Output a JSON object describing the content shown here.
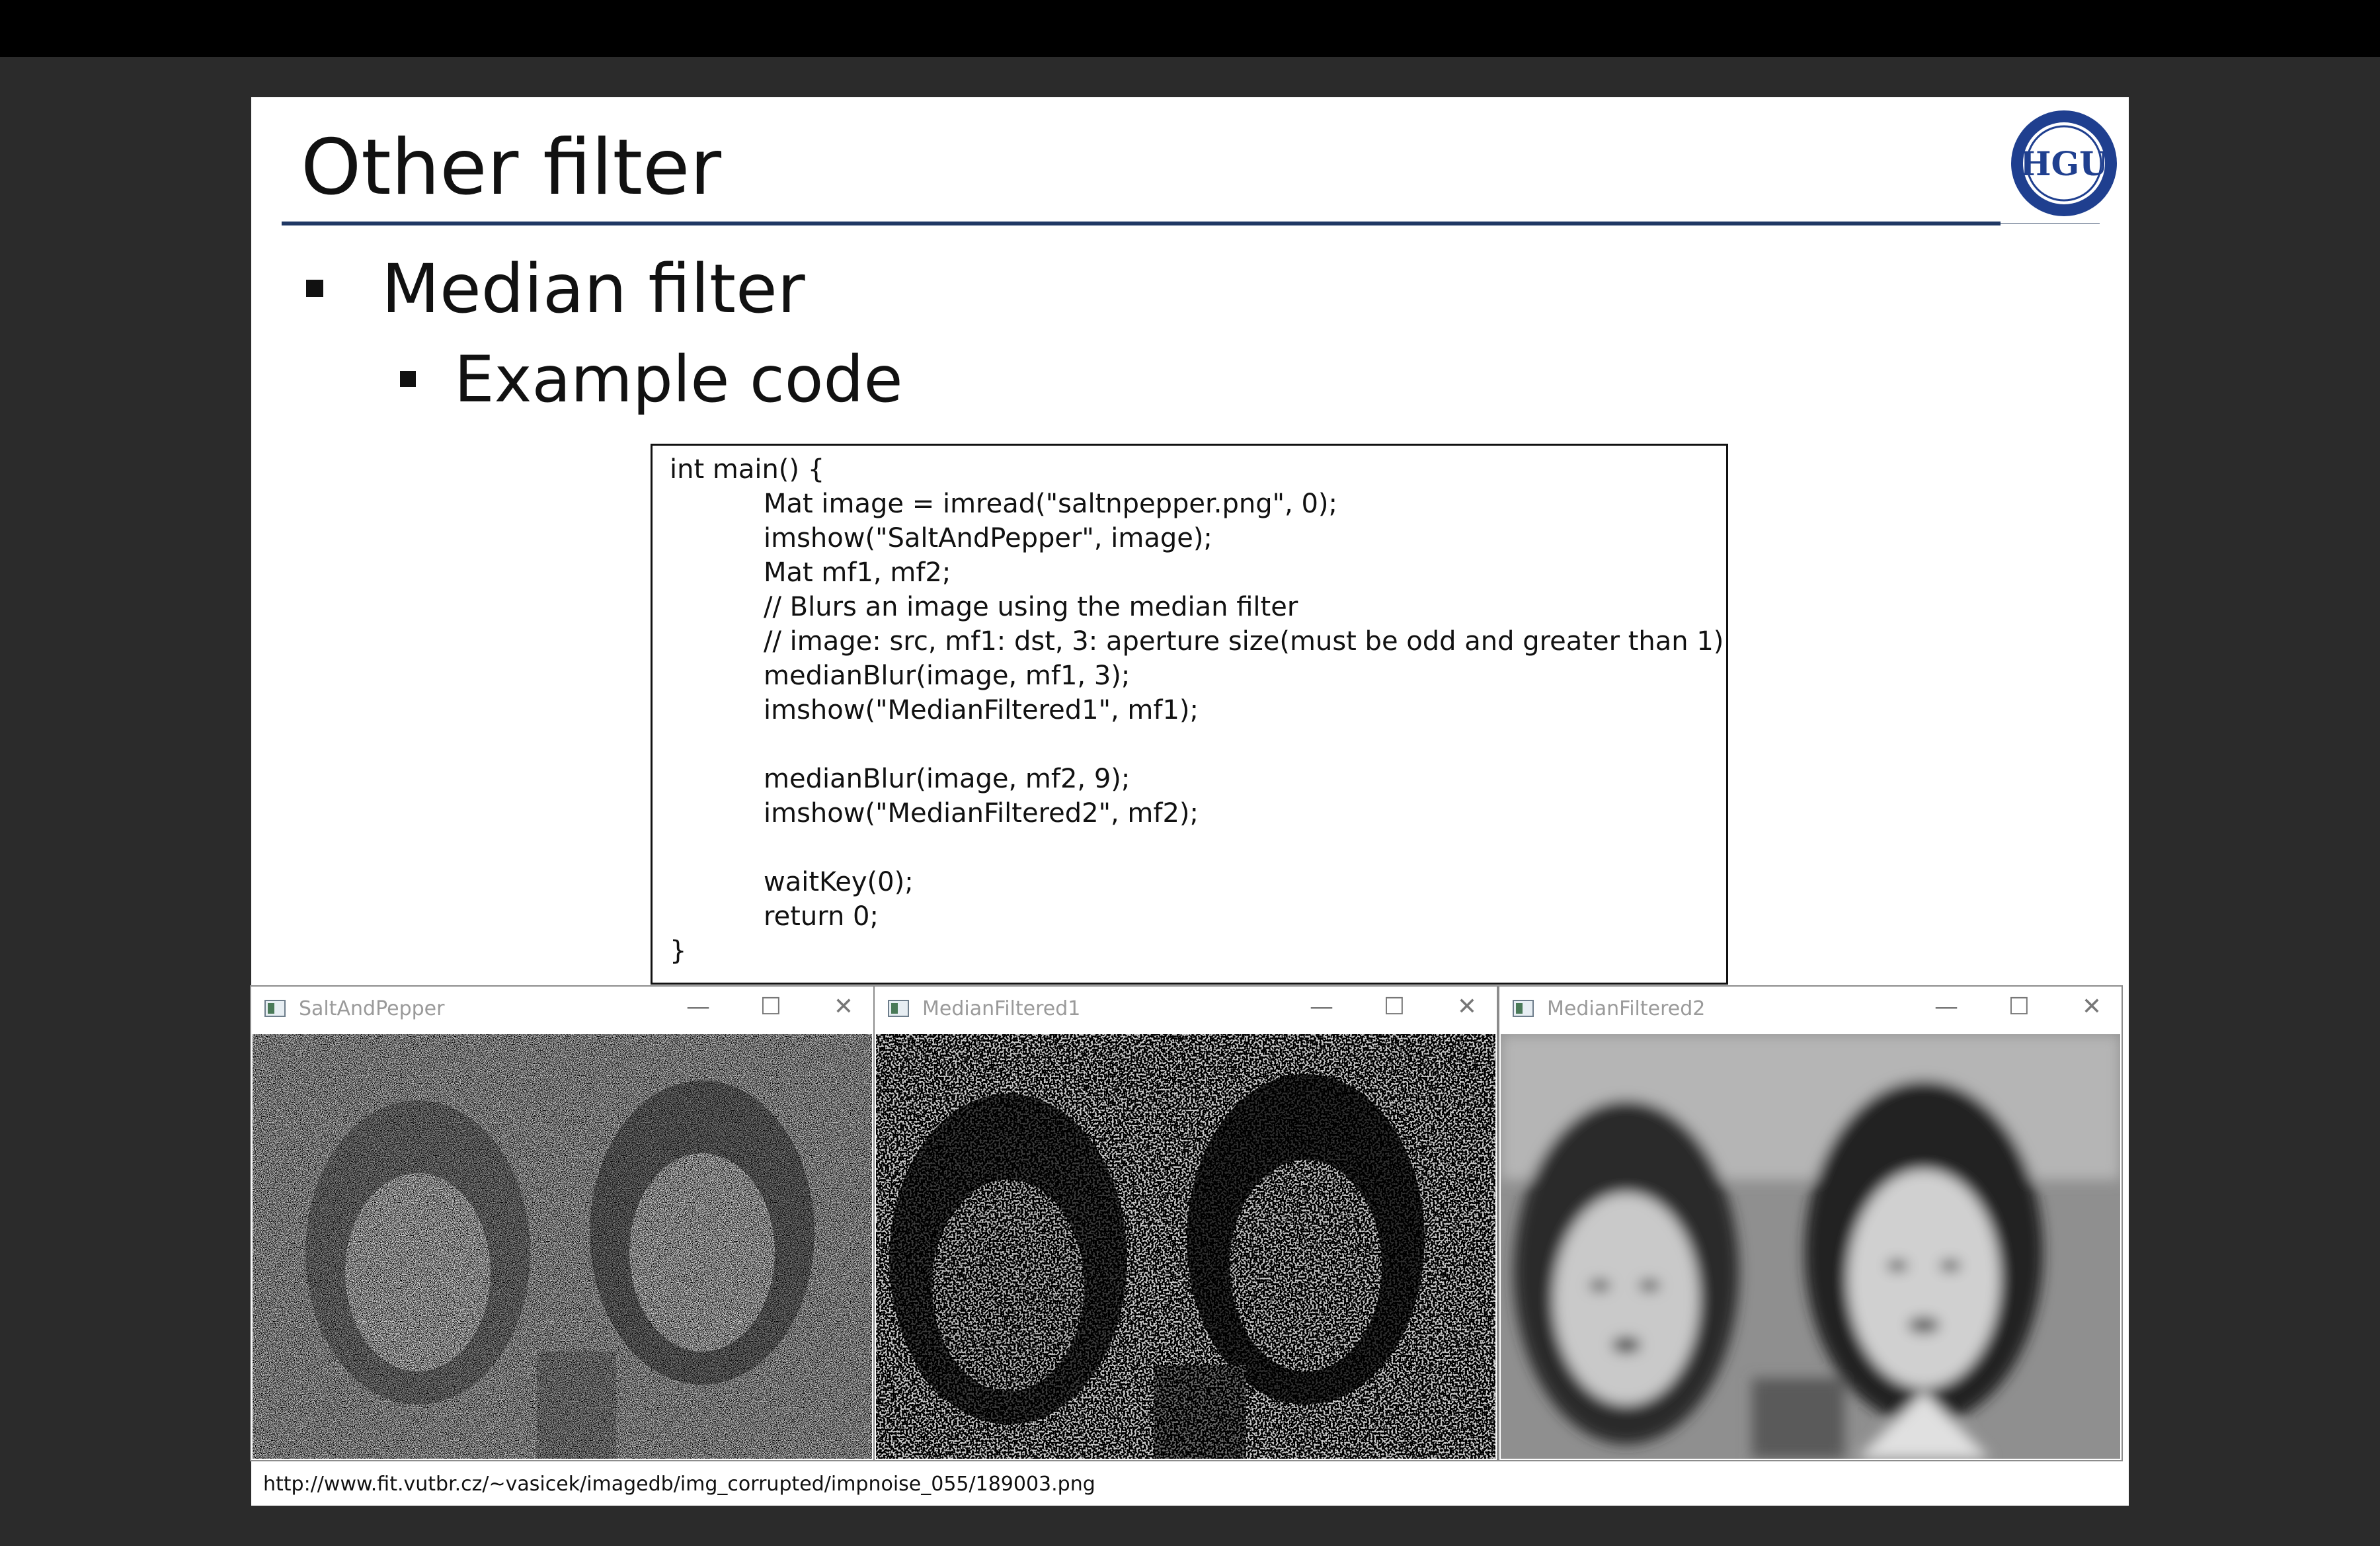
{
  "slide": {
    "title": "Other filter",
    "bullet_level1": "Median filter",
    "bullet_level2": "Example code",
    "logo_text": "HGU",
    "code_lines": [
      "int main() {",
      "Mat image = imread(\"saltnpepper.png\", 0);",
      "imshow(\"SaltAndPepper\", image);",
      "Mat mf1, mf2;",
      "// Blurs an image using the median filter",
      "// image: src, mf1: dst, 3: aperture size(must be odd and greater than 1)",
      "medianBlur(image, mf1, 3);",
      "imshow(\"MedianFiltered1\", mf1);",
      "",
      "medianBlur(image, mf2, 9);",
      "imshow(\"MedianFiltered2\", mf2);",
      "",
      "waitKey(0);",
      "return 0;",
      "}"
    ],
    "windows": [
      {
        "title": "SaltAndPepper",
        "minimize": "—",
        "maximize": "☐",
        "close": "✕"
      },
      {
        "title": "MedianFiltered1",
        "minimize": "—",
        "maximize": "☐",
        "close": "✕"
      },
      {
        "title": "MedianFiltered2",
        "minimize": "—",
        "maximize": "☐",
        "close": "✕"
      }
    ],
    "source_url": "http://www.fit.vutbr.cz/~vasicek/imagedb/img_corrupted/impnoise_055/189003.png"
  },
  "colors": {
    "background": "#2b2b2b",
    "top_bar": "#000000",
    "slide": "#ffffff",
    "title_rule": "#1f3864"
  }
}
